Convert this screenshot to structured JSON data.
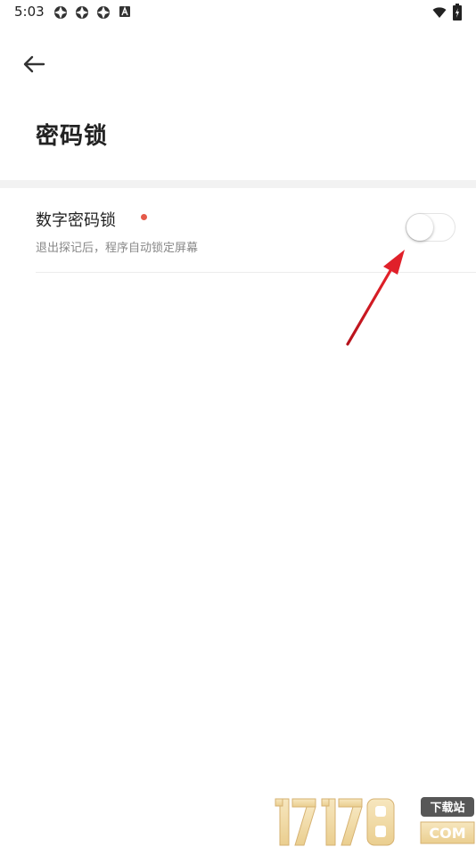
{
  "status_bar": {
    "time": "5:03",
    "icons": [
      "app-notification-icon",
      "app-notification-icon",
      "app-notification-icon",
      "a-notification-icon",
      "wifi-icon",
      "battery-charging-icon"
    ]
  },
  "header": {
    "back_icon": "arrow-left-icon",
    "title": "密码锁"
  },
  "settings": {
    "items": [
      {
        "title": "数字密码锁",
        "description": "退出探记后，程序自动锁定屏幕",
        "enabled": false,
        "has_new_badge": true
      }
    ]
  },
  "annotation": {
    "arrow_color": "#d9181f"
  },
  "watermark": {
    "text": "17178",
    "badge": "下载站",
    "suffix": "COM"
  },
  "colors": {
    "background": "#ffffff",
    "section_band": "#f2f2f2",
    "badge_dot": "#e55a4a",
    "title_text": "#222222",
    "description_text": "#888888"
  }
}
